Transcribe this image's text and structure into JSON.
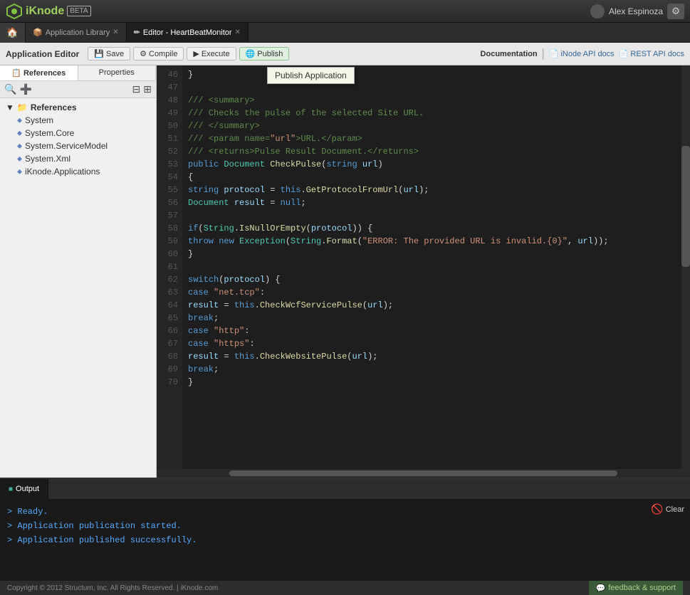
{
  "titlebar": {
    "logo_text": "iKnode",
    "beta": "BETA",
    "user": "Alex Espinoza"
  },
  "tabs": {
    "home_label": "🏠",
    "app_tab": "Application Library",
    "editor_tab": "Editor - HeartBeatMonitor"
  },
  "toolbar": {
    "title": "Application Editor",
    "save_label": "Save",
    "compile_label": "Compile",
    "execute_label": "Execute",
    "publish_label": "Publish",
    "doc_label": "Documentation",
    "inode_api": "iNode API docs",
    "rest_api": "REST API docs",
    "publish_tooltip": "Publish Application"
  },
  "sidebar": {
    "tab_references": "References",
    "tab_properties": "Properties",
    "tree_root": "References",
    "items": [
      {
        "label": "System",
        "indent": 1
      },
      {
        "label": "System.Core",
        "indent": 1
      },
      {
        "label": "System.ServiceModel",
        "indent": 1
      },
      {
        "label": "System.Xml",
        "indent": 1
      },
      {
        "label": "iKnode.Applications",
        "indent": 1
      }
    ]
  },
  "code": {
    "lines": [
      {
        "num": 46,
        "content": "        }"
      },
      {
        "num": 47,
        "content": ""
      },
      {
        "num": 48,
        "content": "        /// <summary>"
      },
      {
        "num": 49,
        "content": "        /// Checks the pulse of the selected Site URL."
      },
      {
        "num": 50,
        "content": "        /// </summary>"
      },
      {
        "num": 51,
        "content": "        /// <param name=\"url\">URL.</param>"
      },
      {
        "num": 52,
        "content": "        /// <returns>Pulse Result Document.</returns>"
      },
      {
        "num": 53,
        "content": "        public Document CheckPulse(string url)"
      },
      {
        "num": 54,
        "content": "        {"
      },
      {
        "num": 55,
        "content": "            string protocol = this.GetProtocolFromUrl(url);"
      },
      {
        "num": 56,
        "content": "            Document result = null;"
      },
      {
        "num": 57,
        "content": ""
      },
      {
        "num": 58,
        "content": "            if(String.IsNullOrEmpty(protocol)) {"
      },
      {
        "num": 59,
        "content": "                throw new Exception(String.Format(\"ERROR: The provided URL is invalid.{0}\", url));"
      },
      {
        "num": 60,
        "content": "            }"
      },
      {
        "num": 61,
        "content": ""
      },
      {
        "num": 62,
        "content": "            switch(protocol) {"
      },
      {
        "num": 63,
        "content": "                case \"net.tcp\":"
      },
      {
        "num": 64,
        "content": "                    result = this.CheckWcfServicePulse(url);"
      },
      {
        "num": 65,
        "content": "                    break;"
      },
      {
        "num": 66,
        "content": "                case \"http\":"
      },
      {
        "num": 67,
        "content": "                case \"https\":"
      },
      {
        "num": 68,
        "content": "                    result = this.CheckWebsitePulse(url);"
      },
      {
        "num": 69,
        "content": "                    break;"
      },
      {
        "num": 70,
        "content": "            }"
      }
    ]
  },
  "output": {
    "tab_label": "Output",
    "lines": [
      "> Ready.",
      "> Application publication started.",
      "> Application published successfully."
    ],
    "clear_label": "Clear"
  },
  "statusbar": {
    "copyright": "Copyright © 2012 Structum, Inc. All Rights Reserved. | iKnode.com",
    "feedback": "feedback & support"
  }
}
